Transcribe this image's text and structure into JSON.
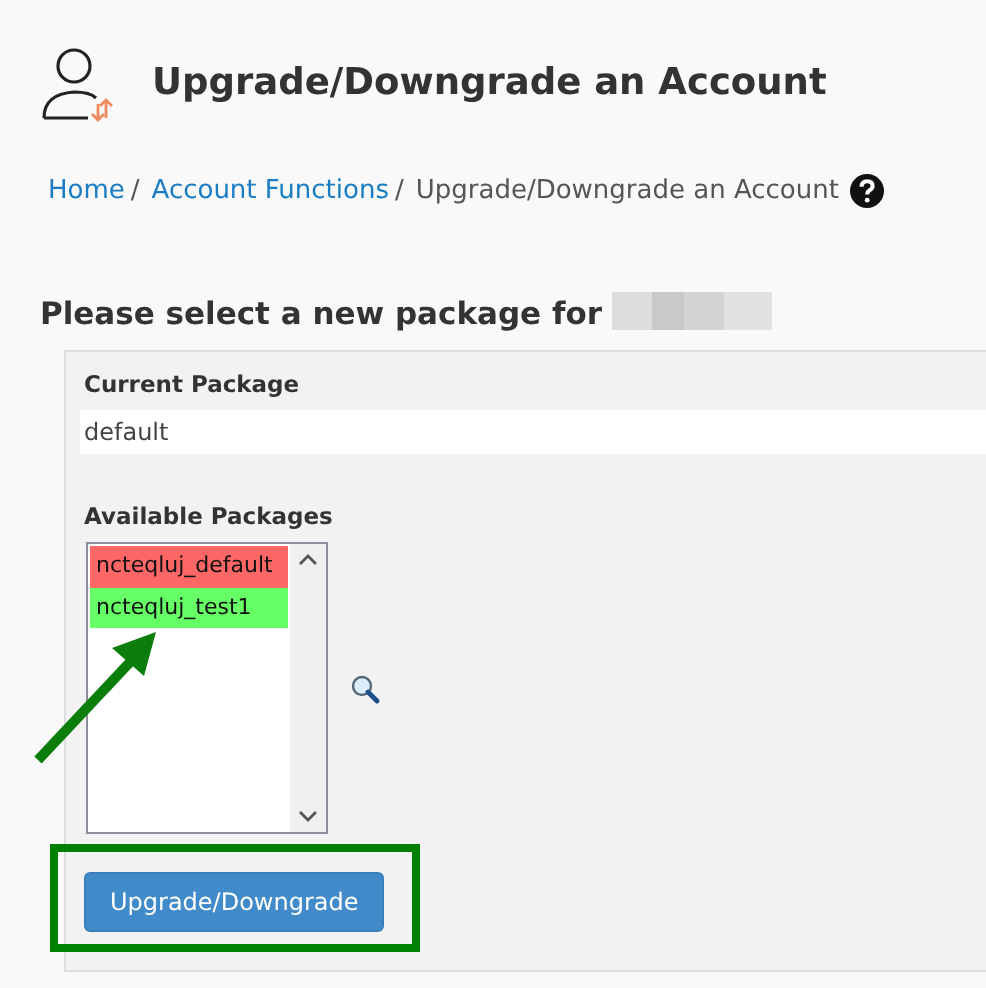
{
  "page_title": "Upgrade/Downgrade an Account",
  "breadcrumb_separator": "/",
  "breadcrumb": [
    {
      "label": "Home",
      "kind": "link"
    },
    {
      "label": "Account Functions",
      "kind": "link"
    },
    {
      "label": "Upgrade/Downgrade an Account",
      "kind": "current"
    }
  ],
  "form": {
    "heading": "Please select a new package for",
    "current_package": {
      "label": "Current Package",
      "value": "default"
    },
    "available_packages": {
      "label": "Available Packages",
      "options": [
        {
          "label": "ncteqluj_default",
          "color": "#ff6666"
        },
        {
          "label": "ncteqluj_test1",
          "color": "#66ff66"
        }
      ]
    },
    "submit_button": "Upgrade/Downgrade"
  }
}
